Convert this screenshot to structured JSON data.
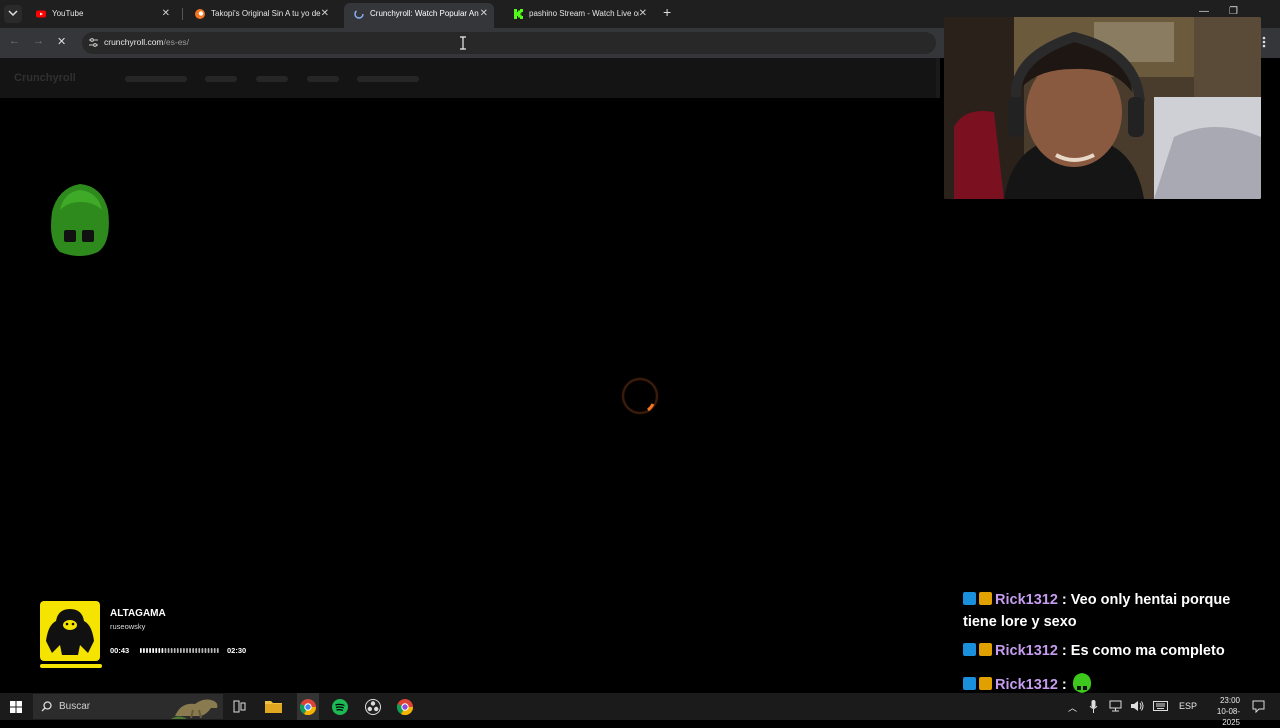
{
  "browser": {
    "tabs": [
      {
        "title": "YouTube",
        "icon": "youtube-icon",
        "active": false
      },
      {
        "title": "Takopi's Original Sin A tu yo de",
        "icon": "crunchyroll-icon",
        "active": false
      },
      {
        "title": "Crunchyroll: Watch Popular An",
        "icon": "loading-icon",
        "active": true
      },
      {
        "title": "pashino Stream - Watch Live or",
        "icon": "kick-icon",
        "active": false
      }
    ],
    "url_domain": "crunchyroll.com",
    "url_path": "/es-es/"
  },
  "page": {
    "logo_text": "Crunchyroll"
  },
  "music": {
    "title": "ALTAGAMA",
    "artist": "ruseowsky",
    "elapsed": "00:43",
    "duration": "02:30",
    "progress": 0.29
  },
  "chat": {
    "messages": [
      {
        "user": "Rick1312",
        "text": "Veo only hentai porque",
        "text2": "tiene lore y sexo"
      },
      {
        "user": "Rick1312",
        "text": "Es como ma completo"
      },
      {
        "user": "Rick1312",
        "text": ""
      }
    ]
  },
  "taskbar": {
    "search_placeholder": "Buscar",
    "language": "ESP",
    "time": "23:00",
    "date": "10-08-2025"
  },
  "colors": {
    "accent_orange": "#f47521",
    "spotify_green": "#1db954",
    "chat_username": "#c59cf0",
    "music_yellow": "#f5e300"
  }
}
